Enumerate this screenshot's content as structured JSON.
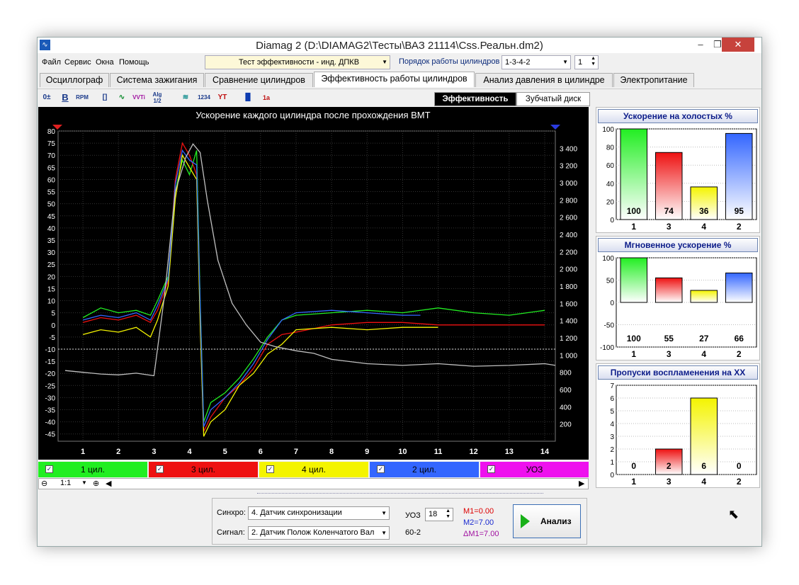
{
  "window": {
    "title": "Diamag 2 (D:\\DIAMAG2\\Тесты\\ВАЗ 21114\\Css.Реальн.dm2)",
    "minimize": "–",
    "restore": "❐",
    "close": "✕"
  },
  "menu": [
    "Файл",
    "Сервис",
    "Окна",
    "Помощь"
  ],
  "test_selector": "Тест эффективности - инд. ДПКВ",
  "firing_order": {
    "label": "Порядок работы цилиндров",
    "value": "1-3-4-2",
    "cylinder": "1"
  },
  "tabs": [
    "Осциллограф",
    "Система зажигания",
    "Сравнение цилиндров",
    "Эффективность работы цилиндров",
    "Анализ давления в цилиндре",
    "Электропитание"
  ],
  "active_tab": 3,
  "toolbar_icons": [
    "0±",
    "B",
    "RPM",
    "[]",
    "∿",
    "VVTi",
    "Alg 1/2",
    "≋",
    "1234",
    "YT",
    "bars",
    "1a"
  ],
  "subtabs": [
    "Эффективность",
    "Зубчатый диск"
  ],
  "colors": {
    "cyl1": "#22ee22",
    "cyl3": "#ee1111",
    "cyl4": "#f4f400",
    "cyl2": "#3366ff",
    "uoz": "#ee11ee",
    "gray": "#c0c0c0"
  },
  "chart_data": [
    {
      "type": "line",
      "title": "Ускорение каждого цилиндра после прохождения ВМТ",
      "x_ticks": [
        "1",
        "2",
        "3",
        "4",
        "5",
        "6",
        "7",
        "8",
        "9",
        "10",
        "11",
        "12",
        "13",
        "14"
      ],
      "y_left_ticks": [
        "80",
        "75",
        "70",
        "65",
        "60",
        "55",
        "50",
        "45",
        "40",
        "35",
        "30",
        "25",
        "20",
        "15",
        "10",
        "5",
        "0",
        "-5",
        "-10",
        "-15",
        "-20",
        "-25",
        "-30",
        "-35",
        "-40",
        "-45"
      ],
      "y_right_ticks": [
        "3 400",
        "3 200",
        "3 000",
        "2 800",
        "2 600",
        "2 400",
        "2 200",
        "2 000",
        "1 800",
        "1 600",
        "1 400",
        "1 200",
        "1 000",
        "800",
        "600",
        "400",
        "200"
      ],
      "xlim": [
        0.3,
        14.3
      ],
      "ylim": [
        -48,
        80
      ],
      "series": [
        {
          "name": "1 цил.",
          "color": "#22ee22",
          "x": [
            1,
            1.5,
            2,
            2.5,
            2.9,
            3.1,
            3.4,
            3.6,
            3.8,
            4,
            4.2,
            4.3,
            4.4,
            4.6,
            5,
            5.4,
            5.8,
            6.2,
            6.6,
            7,
            8,
            9,
            10,
            11,
            12,
            13,
            14
          ],
          "y": [
            3,
            7,
            5,
            6,
            4,
            10,
            20,
            55,
            68,
            62,
            72,
            10,
            -40,
            -32,
            -28,
            -22,
            -14,
            -5,
            2,
            4,
            5,
            6,
            5,
            7,
            5,
            4,
            6
          ]
        },
        {
          "name": "3 цил.",
          "color": "#ee1111",
          "x": [
            1,
            1.5,
            2,
            2.5,
            2.9,
            3.1,
            3.4,
            3.6,
            3.8,
            4,
            4.2,
            4.3,
            4.4,
            4.6,
            5,
            5.4,
            5.8,
            6.2,
            6.6,
            7,
            8,
            9,
            10,
            11,
            12,
            13,
            14
          ],
          "y": [
            1,
            3,
            2,
            4,
            1,
            6,
            18,
            60,
            75,
            70,
            62,
            5,
            -44,
            -38,
            -30,
            -25,
            -18,
            -8,
            -4,
            -3,
            0,
            1,
            1,
            0,
            0,
            0,
            0
          ]
        },
        {
          "name": "4 цил.",
          "color": "#f4f400",
          "x": [
            1,
            1.5,
            2,
            2.5,
            2.9,
            3.1,
            3.4,
            3.6,
            3.8,
            4,
            4.2,
            4.3,
            4.4,
            4.6,
            5,
            5.4,
            5.8,
            6.2,
            6.6,
            7,
            8,
            9,
            10,
            11
          ],
          "y": [
            -4,
            -2,
            -3,
            -1,
            -5,
            2,
            16,
            52,
            70,
            65,
            60,
            0,
            -46,
            -40,
            -35,
            -25,
            -20,
            -12,
            -8,
            -2,
            -1,
            -2,
            -1,
            -1
          ]
        },
        {
          "name": "2 цил.",
          "color": "#3366ff",
          "x": [
            1,
            1.5,
            2,
            2.5,
            2.9,
            3.1,
            3.4,
            3.6,
            3.8,
            4,
            4.2,
            4.3,
            4.4,
            4.6,
            5,
            5.4,
            5.8,
            6.2,
            6.6,
            7,
            8,
            9,
            10,
            10.5
          ],
          "y": [
            2,
            4,
            3,
            5,
            2,
            8,
            19,
            58,
            72,
            68,
            66,
            8,
            -42,
            -35,
            -30,
            -24,
            -16,
            -6,
            2,
            5,
            6,
            5,
            4,
            4
          ]
        },
        {
          "name": "УОЗ",
          "color": "#c0c0c0",
          "x": [
            0.5,
            1,
            1.5,
            2,
            2.5,
            3,
            3.3,
            3.6,
            3.9,
            4.1,
            4.3,
            4.5,
            4.8,
            5.2,
            5.6,
            6,
            6.4,
            7,
            7.5,
            8,
            9,
            10,
            11,
            12,
            13,
            14,
            14.3
          ],
          "y": [
            820,
            800,
            780,
            770,
            790,
            760,
            1700,
            2900,
            3300,
            3450,
            3350,
            2800,
            2100,
            1600,
            1350,
            1150,
            1100,
            1050,
            1020,
            950,
            900,
            880,
            900,
            870,
            880,
            900,
            880
          ]
        }
      ]
    },
    {
      "type": "bar",
      "title": "Ускорение на холостых %",
      "categories": [
        "1",
        "3",
        "4",
        "2"
      ],
      "values": [
        100,
        74,
        36,
        95
      ],
      "ylim": [
        0,
        100
      ],
      "y_ticks": [
        "100",
        "80",
        "60",
        "40",
        "20",
        "0"
      ]
    },
    {
      "type": "bar",
      "title": "Мгновенное ускорение %",
      "categories": [
        "1",
        "3",
        "4",
        "2"
      ],
      "values": [
        100,
        55,
        27,
        66
      ],
      "ylim": [
        -100,
        100
      ],
      "y_ticks": [
        "100",
        "50",
        "0",
        "-50",
        "-100"
      ]
    },
    {
      "type": "bar",
      "title": "Пропуски воспламенения на ХХ",
      "categories": [
        "1",
        "3",
        "4",
        "2"
      ],
      "values": [
        0,
        2,
        6,
        0
      ],
      "ylim": [
        0,
        7
      ],
      "y_ticks": [
        "7",
        "6",
        "5",
        "4",
        "3",
        "2",
        "1",
        "0"
      ]
    }
  ],
  "legend": [
    {
      "label": "1 цил.",
      "color": "#22ee22"
    },
    {
      "label": "3 цил.",
      "color": "#ee1111"
    },
    {
      "label": "4 цил.",
      "color": "#f4f400"
    },
    {
      "label": "2 цил.",
      "color": "#3366ff"
    },
    {
      "label": "УОЗ",
      "color": "#ee11ee"
    }
  ],
  "zoom": "1:1",
  "bottom": {
    "sync_label": "Синхро:",
    "sync_value": "4. Датчик синхронизации",
    "signal_label": "Сигнал:",
    "signal_value": "2. Датчик Полож Коленчатого Вал",
    "uoz_label": "УОЗ",
    "uoz_value": "18",
    "teeth": "60-2",
    "m1": "M1=0.00",
    "m2": "M2=7.00",
    "dm1": "ΔM1=7.00",
    "analyze": "Анализ"
  }
}
